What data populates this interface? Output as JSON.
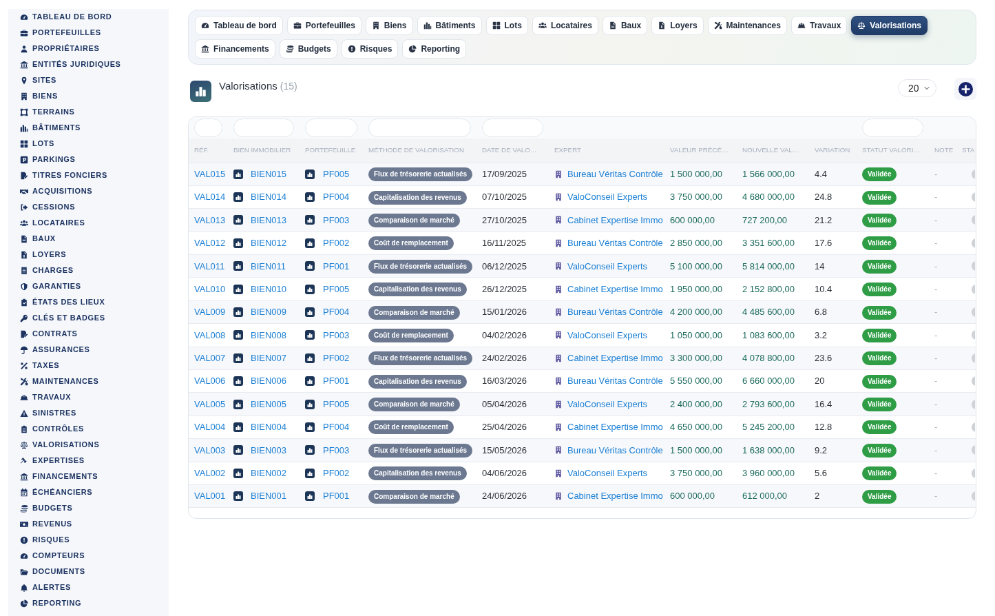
{
  "sidebar": {
    "items": [
      "TABLEAU DE BORD",
      "PORTEFEUILLES",
      "PROPRIÉTAIRES",
      "ENTITÉS JURIDIQUES",
      "SITES",
      "BIENS",
      "TERRAINS",
      "BÂTIMENTS",
      "LOTS",
      "PARKINGS",
      "TITRES FONCIERS",
      "ACQUISITIONS",
      "CESSIONS",
      "LOCATAIRES",
      "BAUX",
      "LOYERS",
      "CHARGES",
      "GARANTIES",
      "ÉTATS DES LIEUX",
      "CLÉS ET BADGES",
      "CONTRATS",
      "ASSURANCES",
      "TAXES",
      "MAINTENANCES",
      "TRAVAUX",
      "SINISTRES",
      "CONTRÔLES",
      "VALORISATIONS",
      "EXPERTISES",
      "FINANCEMENTS",
      "ÉCHÉANCIERS",
      "BUDGETS",
      "REVENUS",
      "RISQUES",
      "COMPTEURS",
      "DOCUMENTS",
      "ALERTES",
      "REPORTING"
    ]
  },
  "nav_tabs": [
    {
      "label": "Tableau de bord",
      "selected": false
    },
    {
      "label": "Portefeuilles",
      "selected": false
    },
    {
      "label": "Biens",
      "selected": false
    },
    {
      "label": "Bâtiments",
      "selected": false
    },
    {
      "label": "Lots",
      "selected": false
    },
    {
      "label": "Locataires",
      "selected": false
    },
    {
      "label": "Baux",
      "selected": false
    },
    {
      "label": "Loyers",
      "selected": false
    },
    {
      "label": "Maintenances",
      "selected": false
    },
    {
      "label": "Travaux",
      "selected": false
    },
    {
      "label": "Valorisations",
      "selected": true
    },
    {
      "label": "Financements",
      "selected": false
    },
    {
      "label": "Budgets",
      "selected": false
    },
    {
      "label": "Risques",
      "selected": false
    },
    {
      "label": "Reporting",
      "selected": false
    }
  ],
  "header": {
    "title": "Valorisations",
    "count": "(15)",
    "page_size": "20"
  },
  "table": {
    "columns": [
      {
        "label": "RÉF.",
        "filter": true
      },
      {
        "label": "BIEN IMMOBILIER",
        "filter": true
      },
      {
        "label": "PORTEFEUILLE",
        "filter": true
      },
      {
        "label": "MÉTHODE DE VALORISATION",
        "filter": true
      },
      {
        "label": "DATE DE VALO…",
        "filter": true
      },
      {
        "label": "EXPERT",
        "filter": false
      },
      {
        "label": "VALEUR PRÉCÉ…",
        "filter": false
      },
      {
        "label": "NOUVELLE VAL…",
        "filter": false
      },
      {
        "label": "VARIATION",
        "filter": false
      },
      {
        "label": "STATUT VALORI…",
        "filter": true
      },
      {
        "label": "NOTE",
        "filter": false
      },
      {
        "label": "STA",
        "filter": false
      }
    ],
    "rows": [
      {
        "ref": "VAL015",
        "property": "BIEN015",
        "portfolio": "PF005",
        "method": "Flux de trésorerie actualisés",
        "date": "17/09/2025",
        "expert": "Bureau Véritas Contrôle",
        "previous_value": "1 500 000,00",
        "new_value": "1 566 000,00",
        "variation": "4.4",
        "status": "Validée",
        "note": "-"
      },
      {
        "ref": "VAL014",
        "property": "BIEN014",
        "portfolio": "PF004",
        "method": "Capitalisation des revenus",
        "date": "07/10/2025",
        "expert": "ValoConseil Experts",
        "previous_value": "3 750 000,00",
        "new_value": "4 680 000,00",
        "variation": "24.8",
        "status": "Validée",
        "note": "-"
      },
      {
        "ref": "VAL013",
        "property": "BIEN013",
        "portfolio": "PF003",
        "method": "Comparaison de marché",
        "date": "27/10/2025",
        "expert": "Cabinet Expertise Immo",
        "previous_value": "600 000,00",
        "new_value": "727 200,00",
        "variation": "21.2",
        "status": "Validée",
        "note": "-"
      },
      {
        "ref": "VAL012",
        "property": "BIEN012",
        "portfolio": "PF002",
        "method": "Coût de remplacement",
        "date": "16/11/2025",
        "expert": "Bureau Véritas Contrôle",
        "previous_value": "2 850 000,00",
        "new_value": "3 351 600,00",
        "variation": "17.6",
        "status": "Validée",
        "note": "-"
      },
      {
        "ref": "VAL011",
        "property": "BIEN011",
        "portfolio": "PF001",
        "method": "Flux de trésorerie actualisés",
        "date": "06/12/2025",
        "expert": "ValoConseil Experts",
        "previous_value": "5 100 000,00",
        "new_value": "5 814 000,00",
        "variation": "14",
        "status": "Validée",
        "note": "-"
      },
      {
        "ref": "VAL010",
        "property": "BIEN010",
        "portfolio": "PF005",
        "method": "Capitalisation des revenus",
        "date": "26/12/2025",
        "expert": "Cabinet Expertise Immo",
        "previous_value": "1 950 000,00",
        "new_value": "2 152 800,00",
        "variation": "10.4",
        "status": "Validée",
        "note": "-"
      },
      {
        "ref": "VAL009",
        "property": "BIEN009",
        "portfolio": "PF004",
        "method": "Comparaison de marché",
        "date": "15/01/2026",
        "expert": "Bureau Véritas Contrôle",
        "previous_value": "4 200 000,00",
        "new_value": "4 485 600,00",
        "variation": "6.8",
        "status": "Validée",
        "note": "-"
      },
      {
        "ref": "VAL008",
        "property": "BIEN008",
        "portfolio": "PF003",
        "method": "Coût de remplacement",
        "date": "04/02/2026",
        "expert": "ValoConseil Experts",
        "previous_value": "1 050 000,00",
        "new_value": "1 083 600,00",
        "variation": "3.2",
        "status": "Validée",
        "note": "-"
      },
      {
        "ref": "VAL007",
        "property": "BIEN007",
        "portfolio": "PF002",
        "method": "Flux de trésorerie actualisés",
        "date": "24/02/2026",
        "expert": "Cabinet Expertise Immo",
        "previous_value": "3 300 000,00",
        "new_value": "4 078 800,00",
        "variation": "23.6",
        "status": "Validée",
        "note": "-"
      },
      {
        "ref": "VAL006",
        "property": "BIEN006",
        "portfolio": "PF001",
        "method": "Capitalisation des revenus",
        "date": "16/03/2026",
        "expert": "Bureau Véritas Contrôle",
        "previous_value": "5 550 000,00",
        "new_value": "6 660 000,00",
        "variation": "20",
        "status": "Validée",
        "note": "-"
      },
      {
        "ref": "VAL005",
        "property": "BIEN005",
        "portfolio": "PF005",
        "method": "Comparaison de marché",
        "date": "05/04/2026",
        "expert": "ValoConseil Experts",
        "previous_value": "2 400 000,00",
        "new_value": "2 793 600,00",
        "variation": "16.4",
        "status": "Validée",
        "note": "-"
      },
      {
        "ref": "VAL004",
        "property": "BIEN004",
        "portfolio": "PF004",
        "method": "Coût de remplacement",
        "date": "25/04/2026",
        "expert": "Cabinet Expertise Immo",
        "previous_value": "4 650 000,00",
        "new_value": "5 245 200,00",
        "variation": "12.8",
        "status": "Validée",
        "note": "-"
      },
      {
        "ref": "VAL003",
        "property": "BIEN003",
        "portfolio": "PF003",
        "method": "Flux de trésorerie actualisés",
        "date": "15/05/2026",
        "expert": "Bureau Véritas Contrôle",
        "previous_value": "1 500 000,00",
        "new_value": "1 638 000,00",
        "variation": "9.2",
        "status": "Validée",
        "note": "-"
      },
      {
        "ref": "VAL002",
        "property": "BIEN002",
        "portfolio": "PF002",
        "method": "Capitalisation des revenus",
        "date": "04/06/2026",
        "expert": "ValoConseil Experts",
        "previous_value": "3 750 000,00",
        "new_value": "3 960 000,00",
        "variation": "5.6",
        "status": "Validée",
        "note": "-"
      },
      {
        "ref": "VAL001",
        "property": "BIEN001",
        "portfolio": "PF001",
        "method": "Comparaison de marché",
        "date": "24/06/2026",
        "expert": "Cabinet Expertise Immo",
        "previous_value": "600 000,00",
        "new_value": "612 000,00",
        "variation": "2",
        "status": "Validée",
        "note": "-"
      }
    ]
  }
}
